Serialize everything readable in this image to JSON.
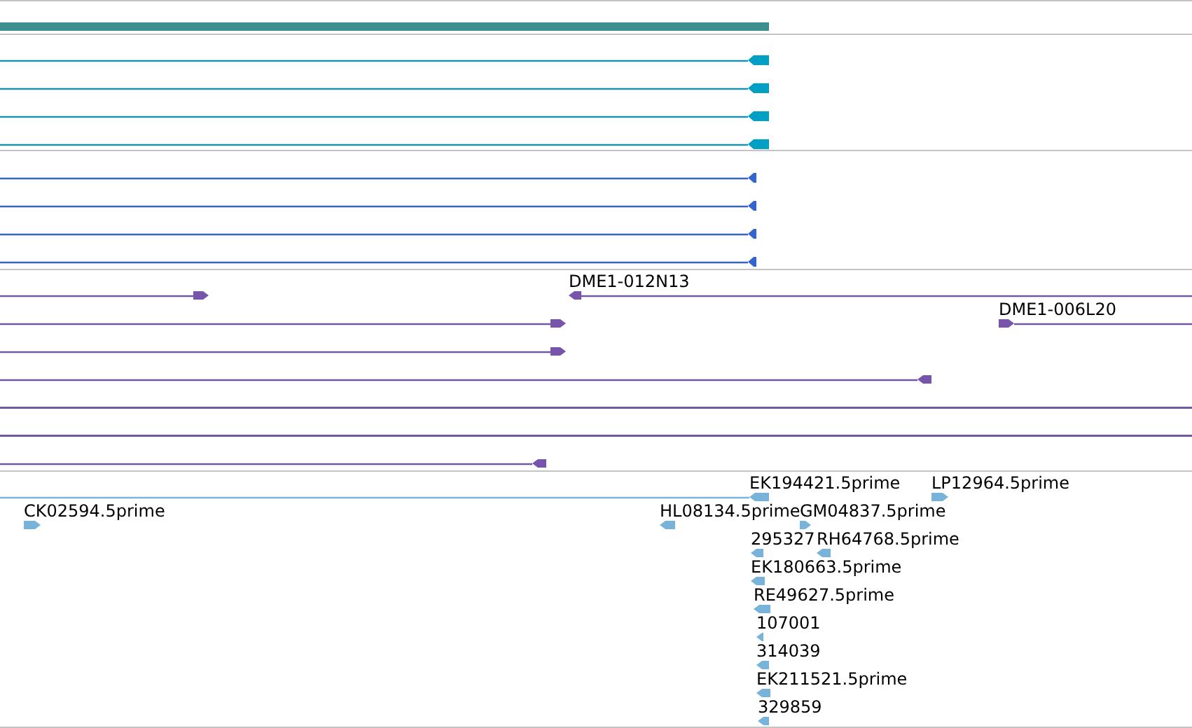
{
  "tracks": [
    {
      "kind": "bar"
    },
    {
      "kind": "block",
      "features": [
        {
          "reverse": true
        },
        {
          "reverse": true
        },
        {
          "reverse": true
        },
        {
          "reverse": true
        }
      ]
    },
    {
      "kind": "arrow",
      "features": [
        {
          "reverse": true
        },
        {
          "reverse": true
        },
        {
          "reverse": true
        },
        {
          "reverse": true
        }
      ]
    },
    {
      "kind": "clone",
      "features": [
        {
          "reverse": false
        },
        {
          "label": "DME1-012N13",
          "reverse": true
        },
        {
          "reverse": false
        },
        {
          "label": "DME1-006L20",
          "reverse": false
        },
        {
          "reverse": false
        },
        {
          "reverse": true
        },
        {
          "arrowhead": false
        },
        {
          "arrowhead": false
        },
        {
          "reverse": true
        }
      ]
    },
    {
      "kind": "est",
      "features": [
        {
          "label": "EK194421.5prime",
          "reverse": true
        },
        {
          "label": "LP12964.5prime",
          "reverse": false
        },
        {
          "label": "CK02594.5prime",
          "reverse": false
        },
        {
          "label": "HL08134.5prime",
          "reverse": true
        },
        {
          "label": "GM04837.5prime",
          "reverse": false
        },
        {
          "label": "295327",
          "reverse": true
        },
        {
          "label": "RH64768.5prime",
          "reverse": true
        },
        {
          "label": "EK180663.5prime",
          "reverse": true
        },
        {
          "label": "RE49627.5prime",
          "reverse": true
        },
        {
          "label": "107001",
          "reverse": true
        },
        {
          "label": "314039",
          "reverse": true
        },
        {
          "label": "EK211521.5prime",
          "reverse": true
        },
        {
          "label": "329859",
          "reverse": true
        }
      ]
    }
  ]
}
